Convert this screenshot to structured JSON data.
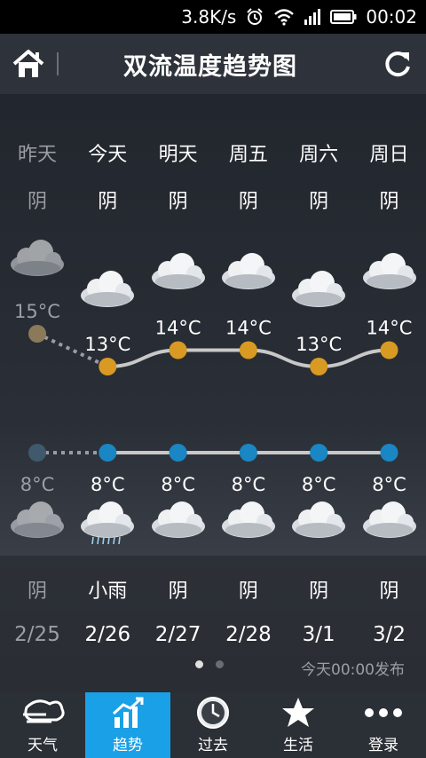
{
  "status_bar": {
    "speed": "3.8K/s",
    "time": "00:02"
  },
  "header": {
    "title": "双流温度趋势图"
  },
  "days": [
    {
      "name": "昨天",
      "weather_top": "阴",
      "high": "15°C",
      "low": "8°C",
      "weather_bottom": "阴",
      "date": "2/25",
      "past": true,
      "icon_top": "cloudy-icon",
      "icon_bottom": "cloudy-icon"
    },
    {
      "name": "今天",
      "weather_top": "阴",
      "high": "13°C",
      "low": "8°C",
      "weather_bottom": "小雨",
      "date": "2/26",
      "past": false,
      "icon_top": "cloudy-icon",
      "icon_bottom": "light-rain-icon"
    },
    {
      "name": "明天",
      "weather_top": "阴",
      "high": "14°C",
      "low": "8°C",
      "weather_bottom": "阴",
      "date": "2/27",
      "past": false,
      "icon_top": "cloudy-icon",
      "icon_bottom": "cloudy-icon"
    },
    {
      "name": "周五",
      "weather_top": "阴",
      "high": "14°C",
      "low": "8°C",
      "weather_bottom": "阴",
      "date": "2/28",
      "past": false,
      "icon_top": "cloudy-icon",
      "icon_bottom": "cloudy-icon"
    },
    {
      "name": "周六",
      "weather_top": "阴",
      "high": "13°C",
      "low": "8°C",
      "weather_bottom": "阴",
      "date": "3/1",
      "past": false,
      "icon_top": "cloudy-icon",
      "icon_bottom": "cloudy-icon"
    },
    {
      "name": "周日",
      "weather_top": "阴",
      "high": "14°C",
      "low": "8°C",
      "weather_bottom": "阴",
      "date": "3/2",
      "past": false,
      "icon_top": "cloudy-icon",
      "icon_bottom": "cloudy-icon"
    }
  ],
  "high_temps": [
    15,
    13,
    14,
    14,
    13,
    14
  ],
  "low_temps": [
    8,
    8,
    8,
    8,
    8,
    8
  ],
  "colors": {
    "high_dot": "#d89a22",
    "low_dot": "#1a86c4",
    "past_dot_high": "#8a7a5a",
    "past_dot_low": "#3e5a6c",
    "line": "#c8c8c8",
    "active_tab": "#1aa0e6"
  },
  "pager": {
    "pages": 2,
    "current": 1
  },
  "published": "今天00:00发布",
  "tabs": [
    {
      "label": "天气",
      "icon": "weather-logo-icon",
      "active": false
    },
    {
      "label": "趋势",
      "icon": "trend-chart-icon",
      "active": true
    },
    {
      "label": "过去",
      "icon": "clock-icon",
      "active": false
    },
    {
      "label": "生活",
      "icon": "star-icon",
      "active": false
    },
    {
      "label": "登录",
      "icon": "more-dots-icon",
      "active": false
    }
  ]
}
